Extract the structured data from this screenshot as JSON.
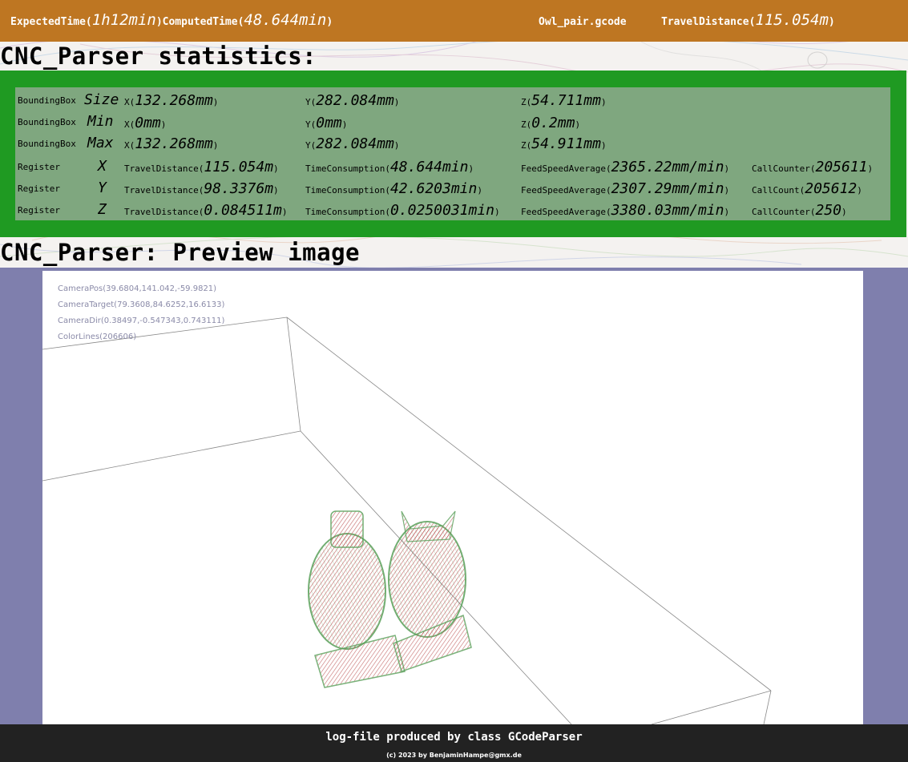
{
  "header": {
    "expected_label": "ExpectedTime(",
    "expected_value": "1h12min",
    "computed_label": ")ComputedTime(",
    "computed_value": "48.644min",
    "close": ")",
    "filename": "Owl_pair.gcode",
    "travel_label": "TravelDistance(",
    "travel_value": "115.054m",
    "travel_close": ")"
  },
  "stats_title": "CNC_Parser statistics:",
  "preview_title": "CNC_Parser: Preview image",
  "bbox": [
    {
      "label": "BoundingBox",
      "kind": "Size",
      "x": "132.268mm",
      "y": "282.084mm",
      "z": "54.711mm"
    },
    {
      "label": "BoundingBox",
      "kind": "Min",
      "x": "0mm",
      "y": "0mm",
      "z": "0.2mm"
    },
    {
      "label": "BoundingBox",
      "kind": "Max",
      "x": "132.268mm",
      "y": "282.084mm",
      "z": "54.911mm"
    }
  ],
  "registers": [
    {
      "label": "Register",
      "axis": "X",
      "travel": "115.054m",
      "time": "48.644min",
      "feed": "2365.22mm/min",
      "counter_label": "CallCounter(",
      "counter": "205611"
    },
    {
      "label": "Register",
      "axis": "Y",
      "travel": "98.3376m",
      "time": "42.6203min",
      "feed": "2307.29mm/min",
      "counter_label": "CallCount(",
      "counter": "205612"
    },
    {
      "label": "Register",
      "axis": "Z",
      "travel": "0.084511m",
      "time": "0.0250031min",
      "feed": "3380.03mm/min",
      "counter_label": "CallCounter(",
      "counter": "250"
    }
  ],
  "labels": {
    "x": "X(",
    "y": "Y(",
    "z": "Z(",
    "close": ")",
    "travel": "TravelDistance(",
    "time": "TimeConsumption(",
    "feed": "FeedSpeedAverage("
  },
  "camera": {
    "pos": "CameraPos(39.6804,141.042,-59.9821)",
    "target": "CameraTarget(79.3608,84.6252,16.6133)",
    "dir": "CameraDir(0.38497,-0.547343,0.743111)",
    "lines": "ColorLines(206606)"
  },
  "footer": {
    "line1": "log-file produced by class GCodeParser",
    "line2": "(c) 2023 by BenjaminHampe@gmx.de"
  },
  "colors": {
    "topbar": "#be7622",
    "stats_outer": "#1f9a22",
    "stats_inner": "#7fa77f",
    "preview_frame": "#7f7fad",
    "footer": "#222222"
  }
}
